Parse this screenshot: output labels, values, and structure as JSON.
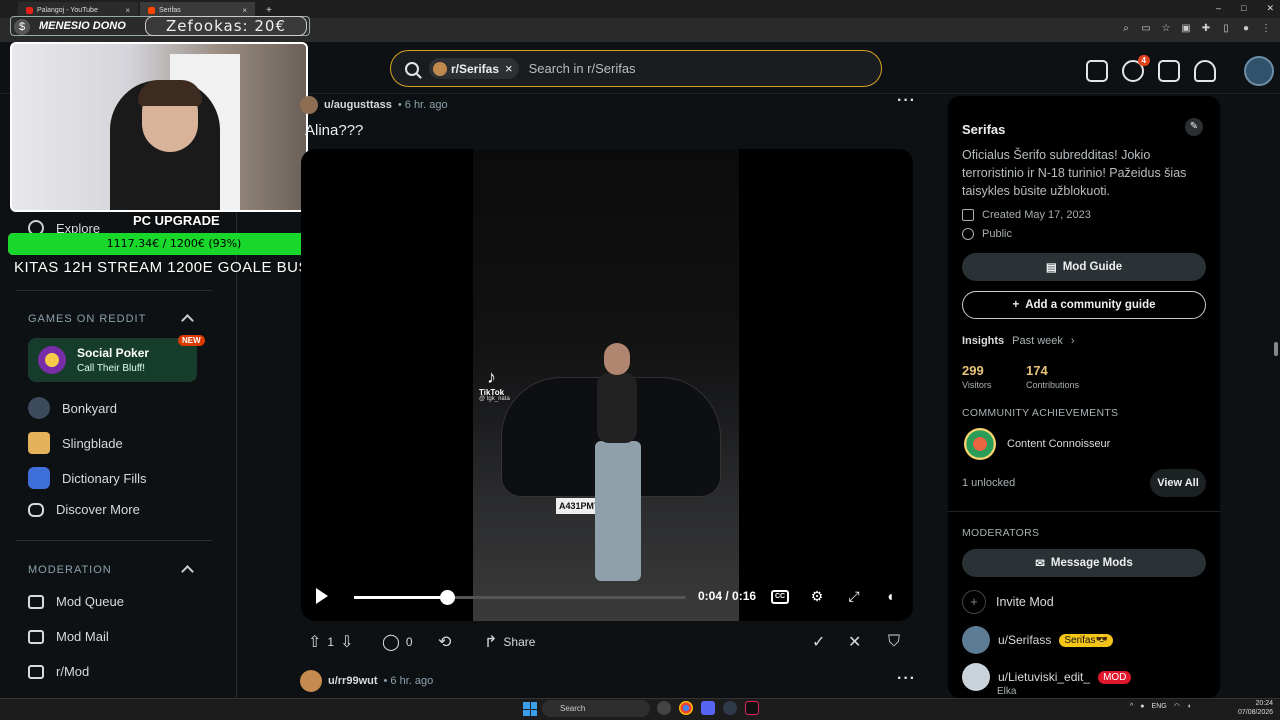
{
  "browser": {
    "tabs": [
      {
        "title": "Palangoj - YouTube",
        "favicon": "youtube-icon"
      },
      {
        "title": "Serifas",
        "favicon": "reddit-icon"
      }
    ],
    "new_tab": "+",
    "window_controls": [
      "–",
      "□",
      "✕"
    ]
  },
  "overlay": {
    "donate_label": "MENESIO DONO",
    "donate_amount": "Zefookas: 20€",
    "dollar_icon": "$",
    "goal_title": "PC UPGRADE",
    "goal_progress_text": "1117.34€ / 1200€ (93%)",
    "goal_progress_fraction": 0.93,
    "goal_footer": "KITAS 12H STREAM 1200E GOALE BUS"
  },
  "header": {
    "search_chip": "r/Serifas",
    "search_placeholder": "Search in r/Serifas",
    "chat_badge": "4"
  },
  "sidebar": {
    "explore_label": "Explore",
    "games_title": "GAMES ON REDDIT",
    "featured_game": {
      "title": "Social Poker",
      "subtitle": "Call Their Bluff!",
      "badge": "NEW"
    },
    "games": [
      "Bonkyard",
      "Slingblade",
      "Dictionary Fills",
      "Discover More"
    ],
    "moderation_title": "MODERATION",
    "moderation": [
      "Mod Queue",
      "Mod Mail",
      "r/Mod"
    ]
  },
  "post": {
    "author": "u/augusttass",
    "age": "• 6 hr. ago",
    "title": "Alina???",
    "tiktok_brand": "TikTok",
    "tiktok_user": "@ tgk_nata",
    "plate": "А431РМ790",
    "video_time": "0:04 / 0:16",
    "video_progress_fraction": 0.28,
    "votes": "1",
    "comments": "0",
    "share_label": "Share"
  },
  "post2": {
    "author": "u/rr99wut",
    "age": "• 6 hr. ago"
  },
  "community": {
    "name": "Serifas",
    "description": "Oficialus Šerifo subredditas! Jokio terroristinio ir N-18 turinio! Pažeidus šias taisykles būsite užblokuoti.",
    "created": "Created May 17, 2023",
    "visibility": "Public",
    "mod_guide_label": "Mod Guide",
    "add_guide_label": "Add a community guide",
    "insights_label": "Insights",
    "insights_period": "Past week",
    "visitors_value": "299",
    "visitors_label": "Visitors",
    "contributions_value": "174",
    "contributions_label": "Contributions",
    "achievements_title": "COMMUNITY ACHIEVEMENTS",
    "achievement_name": "Content Connoisseur",
    "unlocked_text": "1 unlocked",
    "view_all_label": "View All",
    "moderators_title": "MODERATORS",
    "message_mods_label": "Message Mods",
    "invite_mod_label": "Invite Mod",
    "mods": [
      {
        "name": "u/Serifass",
        "flair": "Serifas😎",
        "flair_color": "#f5c518"
      },
      {
        "name": "u/Lietuviski_edit_",
        "flair": "MOD",
        "flair_color": "#e0182d",
        "sub": "Elka"
      }
    ]
  },
  "taskbar": {
    "search_label": "Search",
    "lang": "ENG",
    "time": "20:24",
    "date": "07/08/2026"
  },
  "colors": {
    "accent_search_border": "#d9a021",
    "progress_green": "#19d72b",
    "new_badge": "#d93a00"
  }
}
